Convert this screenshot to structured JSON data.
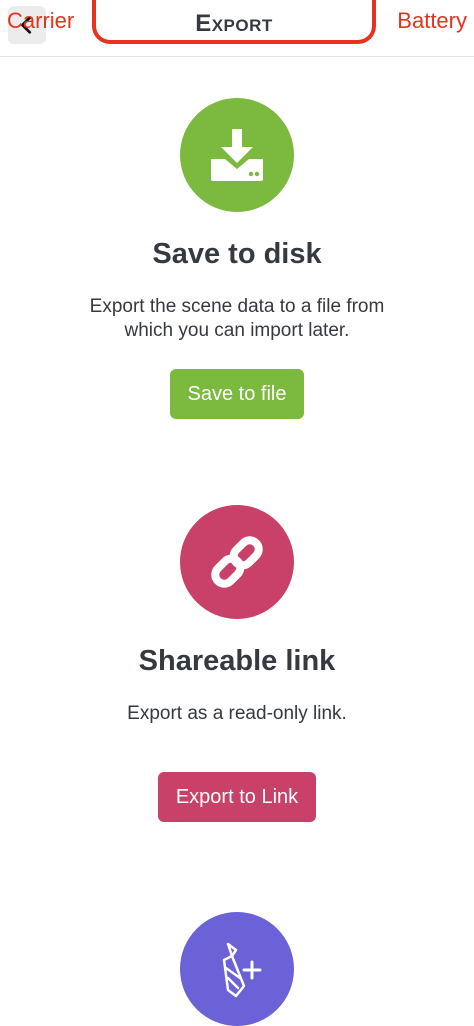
{
  "status_bar": {
    "carrier": "Carrier",
    "battery": "Battery"
  },
  "header": {
    "title": "Export",
    "back_icon": "chevron-left-icon"
  },
  "sections": [
    {
      "icon": "download-disk-icon",
      "color": "#7cb93f",
      "title": "Save to disk",
      "description": "Export the scene data to a file from which you can import later.",
      "button_label": "Save to file"
    },
    {
      "icon": "link-icon",
      "color": "#c94069",
      "title": "Shareable link",
      "description": "Export as a read-only link.",
      "button_label": "Export to Link"
    },
    {
      "icon": "tie-plus-icon",
      "color": "#6a62d6"
    }
  ]
}
